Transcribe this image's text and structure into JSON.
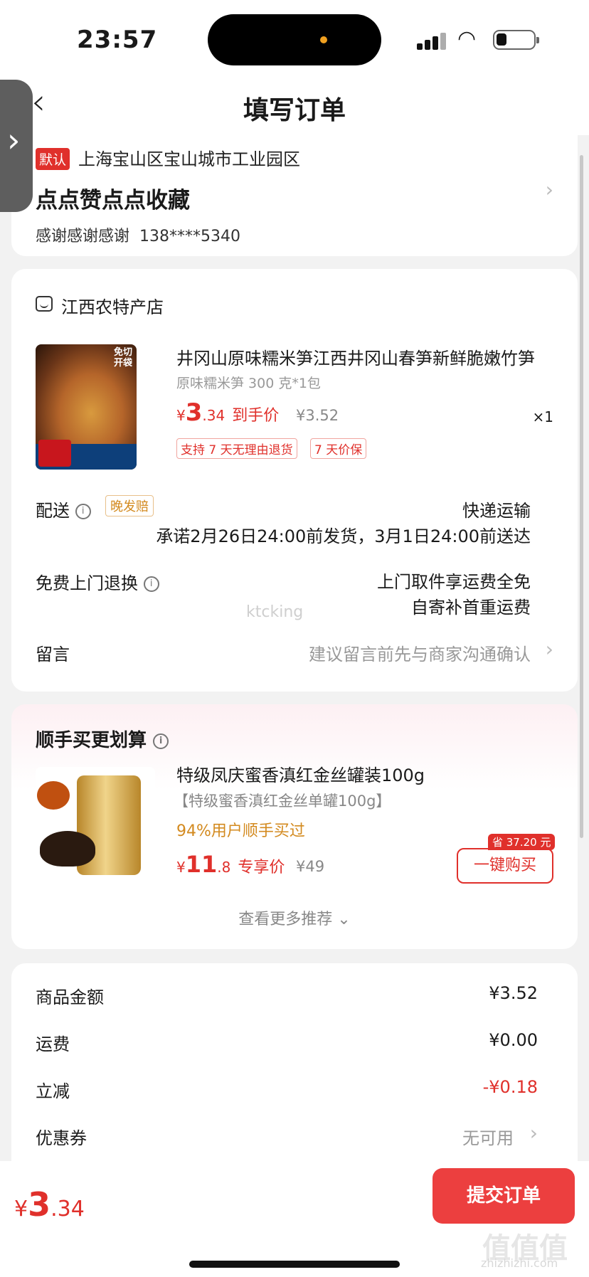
{
  "status_bar": {
    "time": "23:57"
  },
  "header": {
    "title": "填写订单",
    "back_glyph": "‹",
    "side_tab_glyph": "›"
  },
  "address": {
    "default_tag": "默认",
    "line": "上海宝山区宝山城市工业园区",
    "name": "点点赞点点收藏",
    "contact_name": "感谢感谢感谢",
    "phone": "138****5340"
  },
  "order": {
    "shop_name": "江西农特产店",
    "product": {
      "title": "井冈山原味糯米笋江西井冈山春笋新鲜脆嫩竹笋",
      "spec": "原味糯米笋 300 克*1包",
      "currency": "¥",
      "price_int": "3",
      "price_dec": ".34",
      "price_label": "到手价",
      "orig_price": "¥3.52",
      "qty": "×1",
      "tags": [
        "支持 7 天无理由退货",
        "7 天价保"
      ]
    },
    "delivery": {
      "label": "配送",
      "late_tag": "晚发赔",
      "method": "快递运输",
      "promise": "承诺2月26日24:00前发货，3月1日24:00前送达"
    },
    "return": {
      "label": "免费上门退换",
      "line1": "上门取件享运费全免",
      "line2": "自寄补首重运费"
    },
    "message": {
      "label": "留言",
      "placeholder": "建议留言前先与商家沟通确认"
    }
  },
  "recommend": {
    "title": "顺手买更划算",
    "product": {
      "name": "特级凤庆蜜香滇红金丝罐装100g",
      "spec": "【特级蜜香滇红金丝单罐100g】",
      "bought": "94%用户顺手买过",
      "currency": "¥",
      "price_int": "11",
      "price_dec": ".8",
      "price_label": "专享价",
      "orig_price": "¥49",
      "save_badge": "省 37.20 元",
      "buy_button": "一键购买"
    },
    "more": "查看更多推荐"
  },
  "summary": {
    "rows": [
      {
        "label": "商品金额",
        "value": "¥3.52"
      },
      {
        "label": "运费",
        "value": "¥0.00"
      },
      {
        "label": "立减",
        "value": "-¥0.18"
      },
      {
        "label": "优惠券",
        "value": "无可用"
      }
    ]
  },
  "bottom": {
    "currency": "¥",
    "total_int": "3",
    "total_dec": ".34",
    "submit": "提交订单"
  },
  "watermarks": {
    "center": "ktcking",
    "corner": "值值值",
    "corner_url": "zhizhizhi.com"
  },
  "colors": {
    "accent": "#e0302b",
    "submit_bg": "#ec3f3f",
    "highlight": "#d38a1f"
  }
}
